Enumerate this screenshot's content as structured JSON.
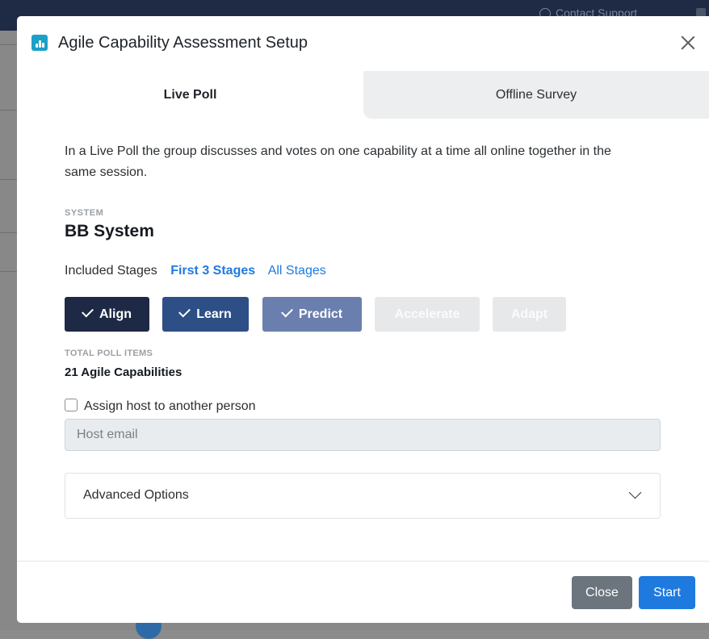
{
  "background": {
    "contact_support": "Contact Support"
  },
  "modal": {
    "title": "Agile Capability Assessment Setup",
    "tabs": [
      {
        "label": "Live Poll",
        "active": true
      },
      {
        "label": "Offline Survey",
        "active": false
      }
    ],
    "description": "In a Live Poll the group discusses and votes on one capability at a time all online together in the same session.",
    "system_label": "SYSTEM",
    "system_name": "BB System",
    "included_stages_label": "Included Stages",
    "stage_options": [
      {
        "label": "First 3 Stages",
        "active": true
      },
      {
        "label": "All Stages",
        "active": false
      }
    ],
    "stages": [
      {
        "label": "Align",
        "selected": true
      },
      {
        "label": "Learn",
        "selected": true
      },
      {
        "label": "Predict",
        "selected": true
      },
      {
        "label": "Accelerate",
        "selected": false
      },
      {
        "label": "Adapt",
        "selected": false
      }
    ],
    "total_poll_items_label": "TOTAL POLL ITEMS",
    "total_poll_items_value": "21 Agile Capabilities",
    "assign_host_label": "Assign host to another person",
    "assign_host_checked": false,
    "host_email_placeholder": "Host email",
    "advanced_options_label": "Advanced Options",
    "footer": {
      "close_label": "Close",
      "start_label": "Start"
    }
  },
  "colors": {
    "primary": "#1f7ae0",
    "align": "#1e2a45",
    "learn": "#2d4f86",
    "predict": "#6a7fae",
    "disabled": "#e7e8ea",
    "icon": "#1ba0c7"
  }
}
